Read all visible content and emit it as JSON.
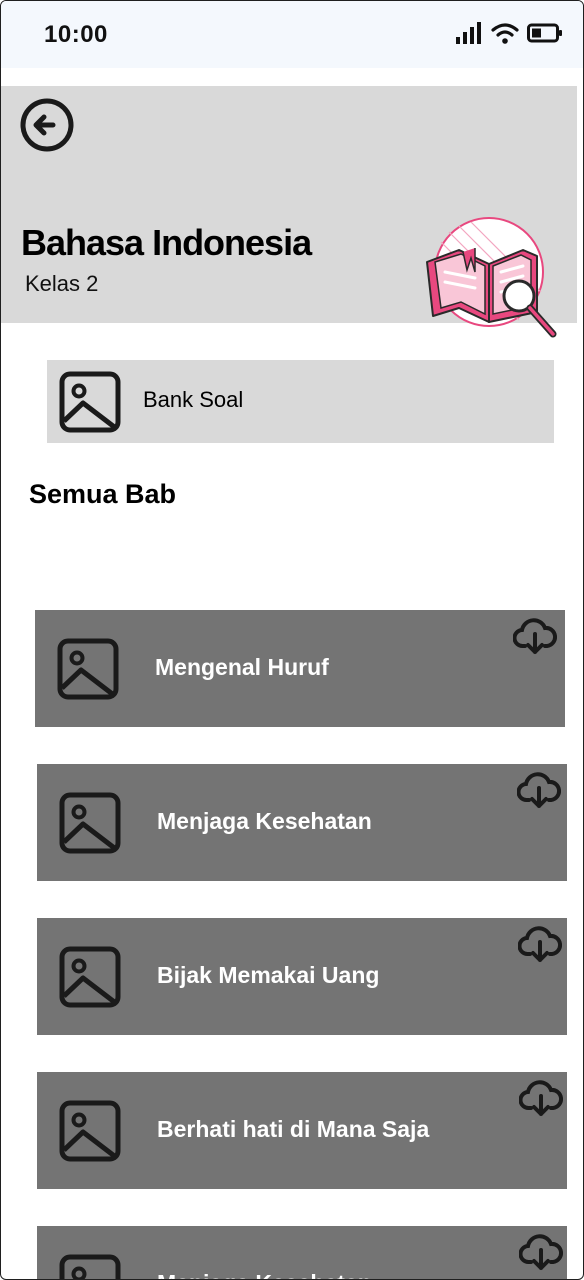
{
  "status_bar": {
    "time": "10:00"
  },
  "header": {
    "title": "Bahasa Indonesia",
    "subtitle": "Kelas 2"
  },
  "bank_soal": {
    "label": "Bank Soal"
  },
  "section": {
    "title": "Semua Bab"
  },
  "chapters": [
    {
      "title": "Mengenal Huruf"
    },
    {
      "title": "Menjaga Kesehatan"
    },
    {
      "title": "Bijak Memakai Uang"
    },
    {
      "title": "Berhati hati di Mana Saja"
    },
    {
      "title": "Menjaga Kesehatan"
    }
  ],
  "icons": {
    "back": "arrow-left-circle-icon",
    "thumbnail": "image-placeholder-icon",
    "download": "cloud-download-icon"
  },
  "colors": {
    "status_bg": "#f4f8fd",
    "header_bg": "#d9d9d9",
    "chapter_bg": "#747474",
    "accent_pink": "#e8487f"
  }
}
